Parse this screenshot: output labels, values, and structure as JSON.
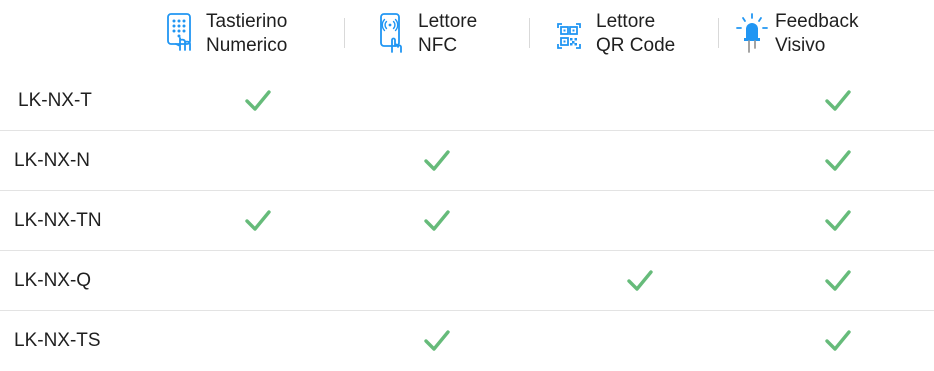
{
  "header": {
    "columns": [
      {
        "line1": "Tastierino",
        "line2": "Numerico",
        "icon": "keypad-hand-icon"
      },
      {
        "line1": "Lettore",
        "line2": "NFC",
        "icon": "nfc-phone-icon"
      },
      {
        "line1": "Lettore",
        "line2": "QR Code",
        "icon": "qr-code-icon"
      },
      {
        "line1": "Feedback",
        "line2": "Visivo",
        "icon": "led-light-icon"
      }
    ]
  },
  "rows": [
    {
      "name": "LK-NX-T",
      "features": [
        true,
        false,
        false,
        true
      ]
    },
    {
      "name": "LK-NX-N",
      "features": [
        false,
        true,
        false,
        true
      ]
    },
    {
      "name": "LK-NX-TN",
      "features": [
        true,
        true,
        false,
        true
      ]
    },
    {
      "name": "LK-NX-Q",
      "features": [
        false,
        false,
        true,
        true
      ]
    },
    {
      "name": "LK-NX-TS",
      "features": [
        false,
        true,
        false,
        true
      ]
    }
  ],
  "colors": {
    "check": "#66bb7a",
    "icon_blue": "#2196f3",
    "icon_grey": "#9a9a9a",
    "text": "#1f1f1f",
    "divider": "#e3e3e3"
  }
}
